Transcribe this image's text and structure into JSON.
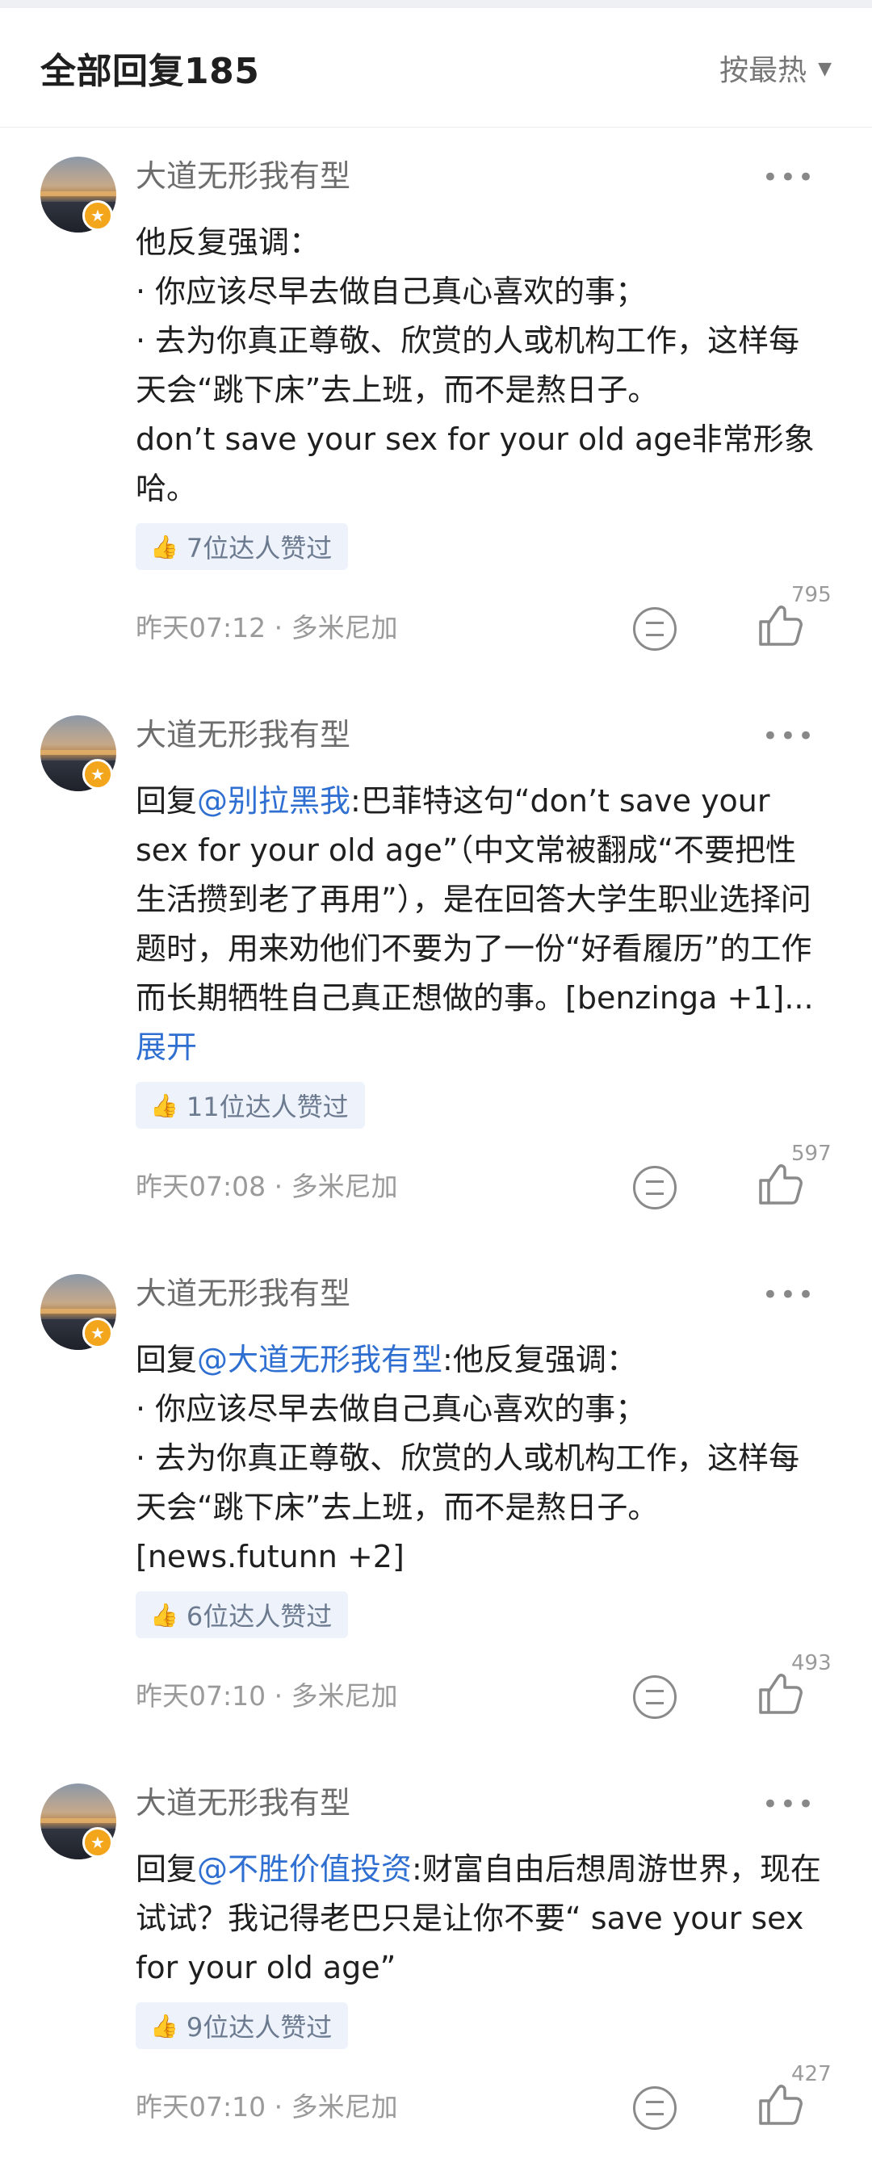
{
  "header": {
    "title": "全部回复185",
    "sort_label": "按最热",
    "sort_icon": "caret-down-icon"
  },
  "comments": [
    {
      "author": "大道无形我有型",
      "text_parts": [
        {
          "type": "text",
          "text": "他反复强调：\n· 你应该尽早去做自己真心喜欢的事；\n· 去为你真正尊敬、欣赏的人或机构工作，这样每天会“跳下床”去上班，而不是熬日子。\ndon’t save your sex for your old age非常形象哈。"
        }
      ],
      "likes_chip": "7位达人赞过",
      "time_location": "昨天07:12 · 多米尼加",
      "like_count": "795"
    },
    {
      "author": "大道无形我有型",
      "text_parts": [
        {
          "type": "text",
          "text": "回复"
        },
        {
          "type": "mention",
          "text": "@别拉黑我"
        },
        {
          "type": "text",
          "text": ":巴菲特这句“don’t save your sex for your old age”（中文常被翻成“不要把性生活攒到老了再用”），是在回答大学生职业选择问题时，用来劝他们不要为了一份“好看履历”的工作而长期牺牲自己真正想做的事。[benzinga +1]... "
        },
        {
          "type": "expand",
          "text": "展开"
        }
      ],
      "likes_chip": "11位达人赞过",
      "time_location": "昨天07:08 · 多米尼加",
      "like_count": "597"
    },
    {
      "author": "大道无形我有型",
      "text_parts": [
        {
          "type": "text",
          "text": "回复"
        },
        {
          "type": "mention",
          "text": "@大道无形我有型"
        },
        {
          "type": "text",
          "text": ":他反复强调：\n· 你应该尽早去做自己真心喜欢的事；\n· 去为你真正尊敬、欣赏的人或机构工作，这样每天会“跳下床”去上班，而不是熬日子。\n[news.futunn +2]"
        }
      ],
      "likes_chip": "6位达人赞过",
      "time_location": "昨天07:10 · 多米尼加",
      "like_count": "493"
    },
    {
      "author": "大道无形我有型",
      "text_parts": [
        {
          "type": "text",
          "text": "回复"
        },
        {
          "type": "mention",
          "text": "@不胜价值投资"
        },
        {
          "type": "text",
          "text": ":财富自由后想周游世界，现在试试？我记得老巴只是让你不要“ save your sex for your old age”"
        }
      ],
      "likes_chip": "9位达人赞过",
      "time_location": "昨天07:10 · 多米尼加",
      "like_count": "427"
    }
  ]
}
